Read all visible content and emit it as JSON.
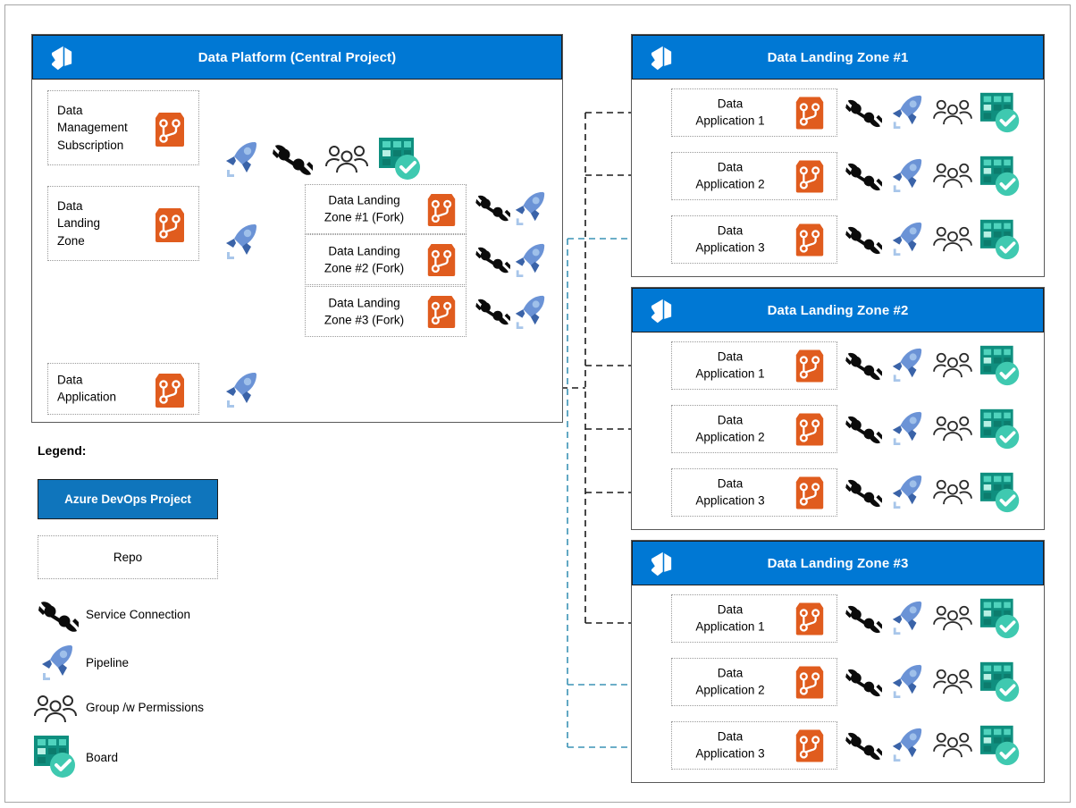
{
  "colors": {
    "ado_blue": "#0078d4",
    "legend_proj_blue": "#0f75bc",
    "repo_orange": "#e05c1e",
    "pipeline_blue": "#4a7ebb",
    "board_teal": "#0f8f7f",
    "board_check": "#3fc9b0",
    "arrow_black": "#1b1b1b",
    "arrow_teal": "#3b93b5",
    "frame_gray": "#a6a6a6"
  },
  "central_panel": {
    "title": "Data Platform (Central Project)",
    "logo_icon": "azure-devops-logo-icon",
    "repos": [
      {
        "id": "data-management-subscription",
        "label": "Data\nManagement\nSubscription",
        "icons": [
          "repo-icon",
          "pipeline-icon",
          "service-connection-icon",
          "group-permissions-icon",
          "board-icon"
        ]
      },
      {
        "id": "data-landing-zone",
        "label": "Data\nLanding\nZone",
        "icons": [
          "repo-icon",
          "pipeline-icon"
        ]
      },
      {
        "id": "data-application",
        "label": "Data\nApplication",
        "icons": [
          "repo-icon",
          "pipeline-icon"
        ]
      }
    ],
    "fork_label": "Fork",
    "fork_label_2": "Fork",
    "fork_repos": [
      {
        "id": "dlz-fork-1",
        "label": "Data Landing\nZone #1 (Fork)",
        "icons": [
          "repo-icon",
          "service-connection-icon",
          "pipeline-icon"
        ]
      },
      {
        "id": "dlz-fork-2",
        "label": "Data Landing\nZone #2 (Fork)",
        "icons": [
          "repo-icon",
          "service-connection-icon",
          "pipeline-icon"
        ]
      },
      {
        "id": "dlz-fork-3",
        "label": "Data Landing\nZone #3 (Fork)",
        "icons": [
          "repo-icon",
          "service-connection-icon",
          "pipeline-icon"
        ]
      }
    ]
  },
  "landing_zones": [
    {
      "id": "data-landing-zone-1",
      "title": "Data Landing Zone #1",
      "logo_icon": "azure-devops-logo-icon",
      "apps": [
        {
          "id": "dlz1-app1",
          "label": "Data\nApplication 1",
          "arrow": "black",
          "icons": [
            "repo-icon",
            "service-connection-icon",
            "pipeline-icon",
            "group-permissions-icon",
            "board-icon"
          ]
        },
        {
          "id": "dlz1-app2",
          "label": "Data\nApplication 2",
          "arrow": "black",
          "icons": [
            "repo-icon",
            "service-connection-icon",
            "pipeline-icon",
            "group-permissions-icon",
            "board-icon"
          ]
        },
        {
          "id": "dlz1-app3",
          "label": "Data\nApplication 3",
          "arrow": "teal",
          "icons": [
            "repo-icon",
            "service-connection-icon",
            "pipeline-icon",
            "group-permissions-icon",
            "board-icon"
          ]
        }
      ]
    },
    {
      "id": "data-landing-zone-2",
      "title": "Data Landing Zone #2",
      "logo_icon": "azure-devops-logo-icon",
      "apps": [
        {
          "id": "dlz2-app1",
          "label": "Data\nApplication 1",
          "arrow": "black",
          "icons": [
            "repo-icon",
            "service-connection-icon",
            "pipeline-icon",
            "group-permissions-icon",
            "board-icon"
          ]
        },
        {
          "id": "dlz2-app2",
          "label": "Data\nApplication 2",
          "arrow": "black",
          "icons": [
            "repo-icon",
            "service-connection-icon",
            "pipeline-icon",
            "group-permissions-icon",
            "board-icon"
          ]
        },
        {
          "id": "dlz2-app3",
          "label": "Data\nApplication 3",
          "arrow": "black",
          "icons": [
            "repo-icon",
            "service-connection-icon",
            "pipeline-icon",
            "group-permissions-icon",
            "board-icon"
          ]
        }
      ]
    },
    {
      "id": "data-landing-zone-3",
      "title": "Data Landing Zone #3",
      "logo_icon": "azure-devops-logo-icon",
      "apps": [
        {
          "id": "dlz3-app1",
          "label": "Data\nApplication 1",
          "arrow": "black",
          "icons": [
            "repo-icon",
            "service-connection-icon",
            "pipeline-icon",
            "group-permissions-icon",
            "board-icon"
          ]
        },
        {
          "id": "dlz3-app2",
          "label": "Data\nApplication 2",
          "arrow": "teal",
          "icons": [
            "repo-icon",
            "service-connection-icon",
            "pipeline-icon",
            "group-permissions-icon",
            "board-icon"
          ]
        },
        {
          "id": "dlz3-app3",
          "label": "Data\nApplication 3",
          "arrow": "teal",
          "icons": [
            "repo-icon",
            "service-connection-icon",
            "pipeline-icon",
            "group-permissions-icon",
            "board-icon"
          ]
        }
      ]
    }
  ],
  "legend": {
    "title": "Legend:",
    "project_box": "Azure DevOps Project",
    "repo_box": "Repo",
    "rows": [
      {
        "icon": "service-connection-icon",
        "label": "Service Connection"
      },
      {
        "icon": "pipeline-icon",
        "label": "Pipeline"
      },
      {
        "icon": "group-permissions-icon",
        "label": "Group /w Permissions"
      },
      {
        "icon": "board-icon",
        "label": "Board"
      }
    ]
  }
}
